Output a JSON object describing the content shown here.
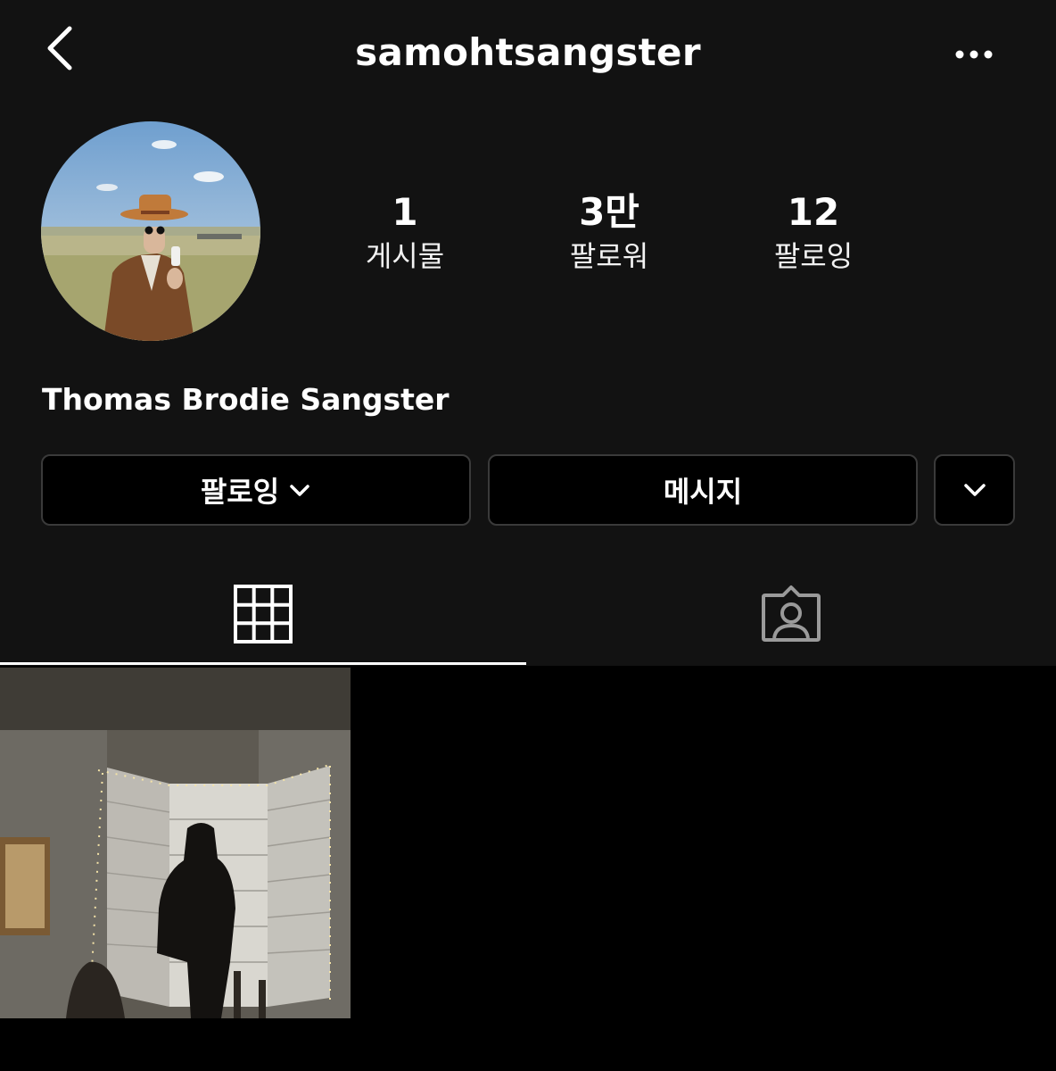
{
  "header": {
    "username": "samohtsangster",
    "back_icon": "chevron-left-icon",
    "more_icon": "ellipsis-icon"
  },
  "profile": {
    "full_name": "Thomas Brodie Sangster",
    "stats": [
      {
        "value": "1",
        "label": "게시물"
      },
      {
        "value": "3만",
        "label": "팔로워"
      },
      {
        "value": "12",
        "label": "팔로잉"
      }
    ]
  },
  "actions": {
    "following_label": "팔로잉",
    "message_label": "메시지",
    "more_icon": "chevron-down-icon"
  },
  "tabs": [
    {
      "icon": "grid-icon",
      "active": true
    },
    {
      "icon": "tagged-person-icon",
      "active": false
    }
  ],
  "colors": {
    "background": "#121212",
    "grid_background": "#000000",
    "button_border": "#3a3a3a",
    "text": "#ffffff"
  }
}
